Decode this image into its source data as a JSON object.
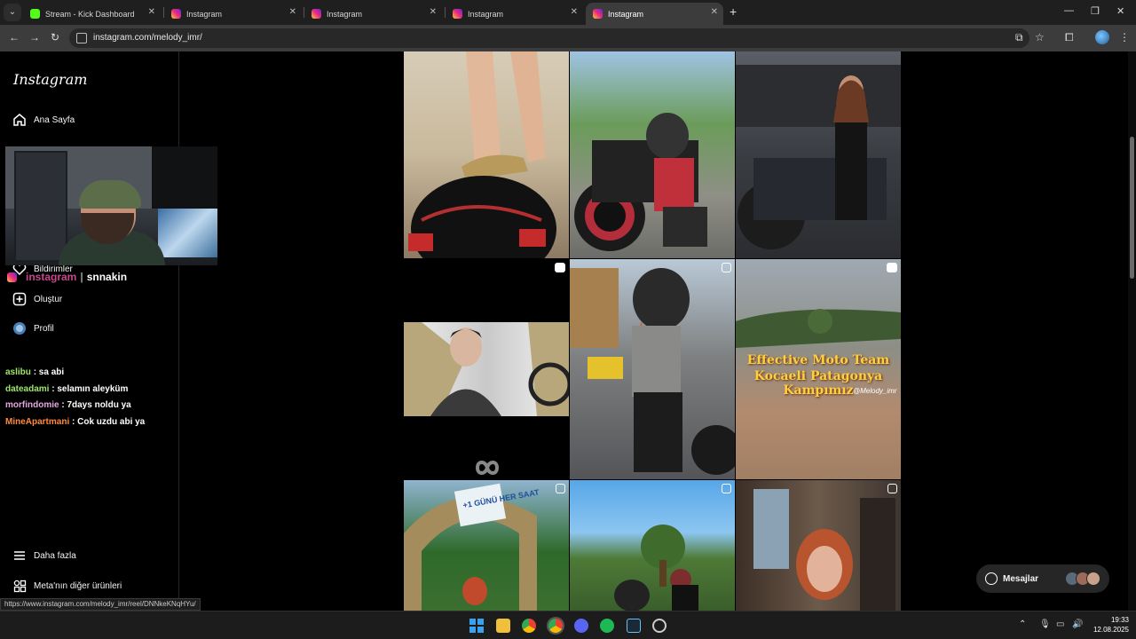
{
  "browser": {
    "tabs": [
      {
        "title": "Stream - Kick Dashboard",
        "favicon": "kick-icon"
      },
      {
        "title": "Instagram",
        "favicon": "instagram-icon"
      },
      {
        "title": "Instagram",
        "favicon": "instagram-icon"
      },
      {
        "title": "Instagram",
        "favicon": "instagram-icon"
      },
      {
        "title": "Instagram",
        "favicon": "instagram-icon",
        "active": true
      }
    ],
    "url": "instagram.com/melody_imr/"
  },
  "sidebar": {
    "logo": "Instagram",
    "items": [
      {
        "label": "Ana Sayfa",
        "icon": "home-icon"
      },
      {
        "label": "Bildirimler",
        "icon": "heart-icon"
      },
      {
        "label": "Oluştur",
        "icon": "plus-square-icon"
      },
      {
        "label": "Profil",
        "icon": "avatar"
      },
      {
        "label": "Daha fazla",
        "icon": "menu-icon"
      },
      {
        "label": "Meta'nın diğer ürünleri",
        "icon": "grid-icon"
      }
    ]
  },
  "stream_overlay": {
    "tag_instagram": "instagram",
    "tag_separator": "|",
    "tag_username": "snnakin",
    "chat": [
      {
        "user": "aslibu",
        "message": ": sa abi",
        "color": "#9ee86b"
      },
      {
        "user": "dateadami",
        "message": ": selamın aleyküm",
        "color": "#9ee86b"
      },
      {
        "user": "morfindomie",
        "message": ": 7days noldu ya",
        "color": "#e6a7e0"
      },
      {
        "user": "MineApartmani",
        "message": ": Cok uzdu abi ya",
        "color": "#ff8a3d"
      }
    ]
  },
  "posts": {
    "caption_line1": "Effective Moto Team",
    "caption_line2": "Kocaeli Patagonya Kampımız",
    "watermark": "@Melody_imr",
    "sign_text": "+1 GÜNÜ HER SAAT",
    "loading_icon": "infinity-icon"
  },
  "messages": {
    "label": "Mesajlar"
  },
  "status_url": "https://www.instagram.com/melody_imr/reel/DNNkeKNqHYu/",
  "taskbar": {
    "time": "19:33",
    "date": "12.08.2025"
  },
  "colors": {
    "accent_instagram": "#ee2a7b",
    "background": "#000000"
  }
}
